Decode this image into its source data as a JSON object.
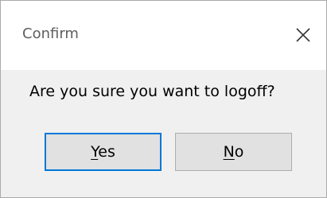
{
  "dialog": {
    "title": "Confirm",
    "close_icon": "close-icon",
    "message": "Are you sure you want to logoff?"
  },
  "buttons": {
    "yes": {
      "mnemonic": "Y",
      "rest": "es"
    },
    "no": {
      "mnemonic": "N",
      "rest": "o"
    }
  },
  "colors": {
    "titlebar_bg": "#ffffff",
    "body_bg": "#f0f0f0",
    "default_button_border": "#0078d7",
    "button_bg": "#e1e1e1"
  }
}
